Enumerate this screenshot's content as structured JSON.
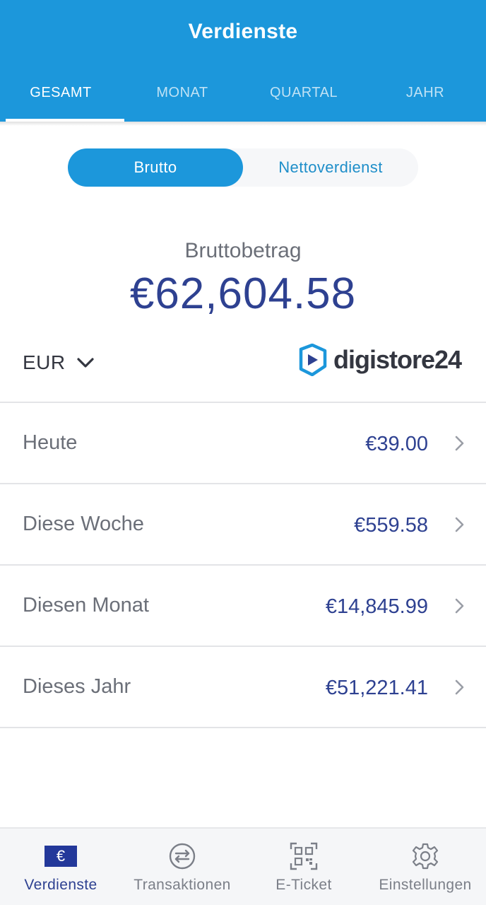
{
  "header": {
    "title": "Verdienste",
    "tabs": [
      {
        "label": "GESAMT",
        "active": true
      },
      {
        "label": "MONAT",
        "active": false
      },
      {
        "label": "QUARTAL",
        "active": false
      },
      {
        "label": "JAHR",
        "active": false
      }
    ]
  },
  "segment": {
    "options": [
      "Brutto",
      "Nettoverdienst"
    ],
    "selected": "Brutto"
  },
  "summary": {
    "label": "Bruttobetrag",
    "amount": "€62,604.58"
  },
  "currency": {
    "selected": "EUR",
    "icon": "chevron-down-icon"
  },
  "brand": {
    "name": "digistore24"
  },
  "periods": [
    {
      "label": "Heute",
      "value": "€39.00"
    },
    {
      "label": "Diese Woche",
      "value": "€559.58"
    },
    {
      "label": "Diesen Monat",
      "value": "€14,845.99"
    },
    {
      "label": "Dieses Jahr",
      "value": "€51,221.41"
    }
  ],
  "bottom_nav": [
    {
      "label": "Verdienste",
      "icon": "euro-icon",
      "active": true
    },
    {
      "label": "Transaktionen",
      "icon": "transfer-icon",
      "active": false
    },
    {
      "label": "E-Ticket",
      "icon": "qr-code-icon",
      "active": false
    },
    {
      "label": "Einstellungen",
      "icon": "gear-icon",
      "active": false
    }
  ],
  "colors": {
    "primary": "#1c97db",
    "amount": "#2e4191",
    "text_secondary": "#6b6f78",
    "divider": "#e3e4e7"
  }
}
